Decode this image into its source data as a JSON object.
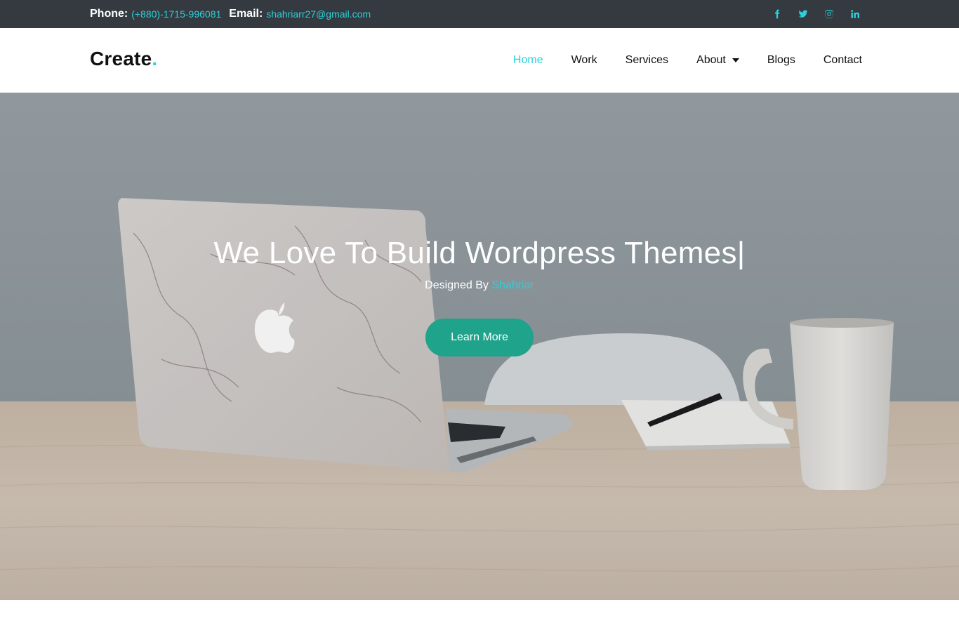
{
  "topbar": {
    "phone_label": "Phone:",
    "phone_value": "(+880)-1715-996081",
    "email_label": "Email:",
    "email_value": "shahriarr27@gmail.com",
    "social_icons": [
      "facebook-icon",
      "twitter-icon",
      "instagram-icon",
      "linkedin-icon"
    ]
  },
  "navbar": {
    "brand": "Create",
    "brand_dot": ".",
    "menu": [
      {
        "label": "Home",
        "active": true
      },
      {
        "label": "Work"
      },
      {
        "label": "Services"
      },
      {
        "label": "About",
        "has_dropdown": true
      },
      {
        "label": "Blogs"
      },
      {
        "label": "Contact"
      }
    ]
  },
  "hero": {
    "title": "We Love To Build Wordpress Themes|",
    "subtitle_prefix": "Designed By",
    "subtitle_name": "Shahriar",
    "button_label": "Learn More"
  },
  "colors": {
    "accent": "#2cd0d8",
    "topbar_bg": "#343a40",
    "button_bg": "#1fa38a"
  }
}
